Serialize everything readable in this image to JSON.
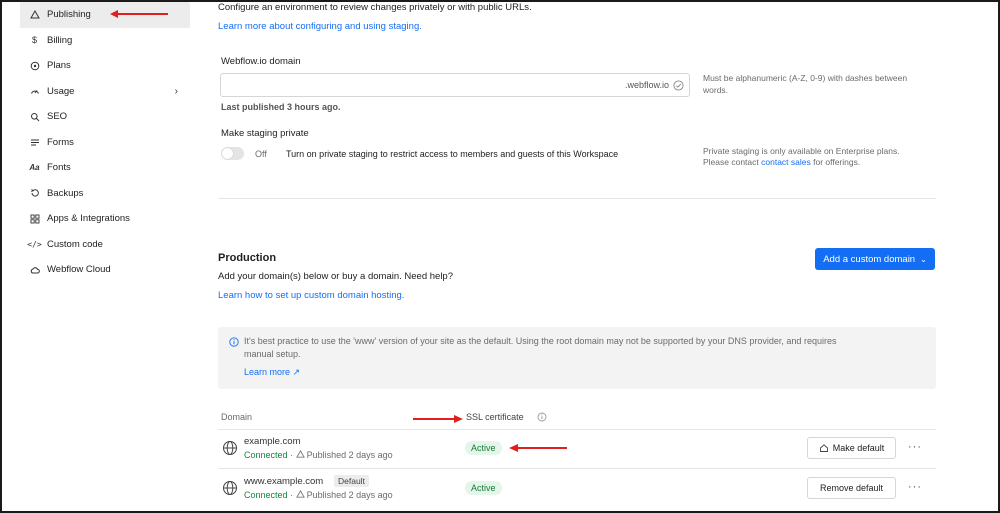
{
  "sidebar": {
    "items": [
      {
        "label": "Publishing",
        "icon": "publishing-icon",
        "active": true
      },
      {
        "label": "Billing",
        "icon": "dollar-icon"
      },
      {
        "label": "Plans",
        "icon": "plans-icon"
      },
      {
        "label": "Usage",
        "icon": "gauge-icon",
        "has_chevron": true
      },
      {
        "label": "SEO",
        "icon": "seo-icon"
      },
      {
        "label": "Forms",
        "icon": "forms-icon"
      },
      {
        "label": "Fonts",
        "icon": "fonts-icon"
      },
      {
        "label": "Backups",
        "icon": "backups-icon"
      },
      {
        "label": "Apps & Integrations",
        "icon": "apps-icon"
      },
      {
        "label": "Custom code",
        "icon": "code-icon"
      },
      {
        "label": "Webflow Cloud",
        "icon": "cloud-icon"
      }
    ],
    "chevron": "›"
  },
  "staging": {
    "description": "Configure an environment to review changes privately or with public URLs.",
    "learn_more": "Learn more about configuring and using staging.",
    "domain_label": "Webflow.io domain",
    "domain_value": "",
    "domain_suffix": ".webflow.io",
    "domain_hint_line1": "Must be alphanumeric (A-Z, 0-9) with dashes between",
    "domain_hint_line2": "words.",
    "last_published": "Last published 3 hours ago.",
    "private_label": "Make staging private",
    "toggle_state": "Off",
    "toggle_text": "Turn on private staging to restrict access to members and guests of this Workspace",
    "private_hint_line1": "Private staging is only available on Enterprise plans.",
    "private_hint_line2_a": "Please contact ",
    "private_hint_link": "contact sales",
    "private_hint_line2_b": " for offerings."
  },
  "production": {
    "title": "Production",
    "subtitle": "Add your domain(s) below or buy a domain. Need help?",
    "learn_more": "Learn how to set up custom domain hosting.",
    "add_button": "Add a custom domain",
    "add_button_caret": "⌄",
    "info_line1": "It's best practice to use the 'www' version of your site as the default. Using the root domain may not be supported by your DNS provider, and requires",
    "info_line2": "manual setup.",
    "info_link": "Learn more ↗"
  },
  "table": {
    "headers": {
      "domain": "Domain",
      "ssl": "SSL certificate"
    },
    "rows": [
      {
        "domain": "example.com",
        "status": "Connected",
        "published": "Published 2 days ago",
        "ssl": "Active",
        "default_badge": "",
        "action": "Make default",
        "more": "···"
      },
      {
        "domain": "www.example.com",
        "status": "Connected",
        "published": "Published 2 days ago",
        "ssl": "Active",
        "default_badge": "Default",
        "action": "Remove default",
        "more": "···"
      }
    ],
    "separator": "·"
  },
  "colors": {
    "accent": "#146ef5",
    "connected": "#0f8a3c",
    "annotation_arrow": "#e02020"
  }
}
